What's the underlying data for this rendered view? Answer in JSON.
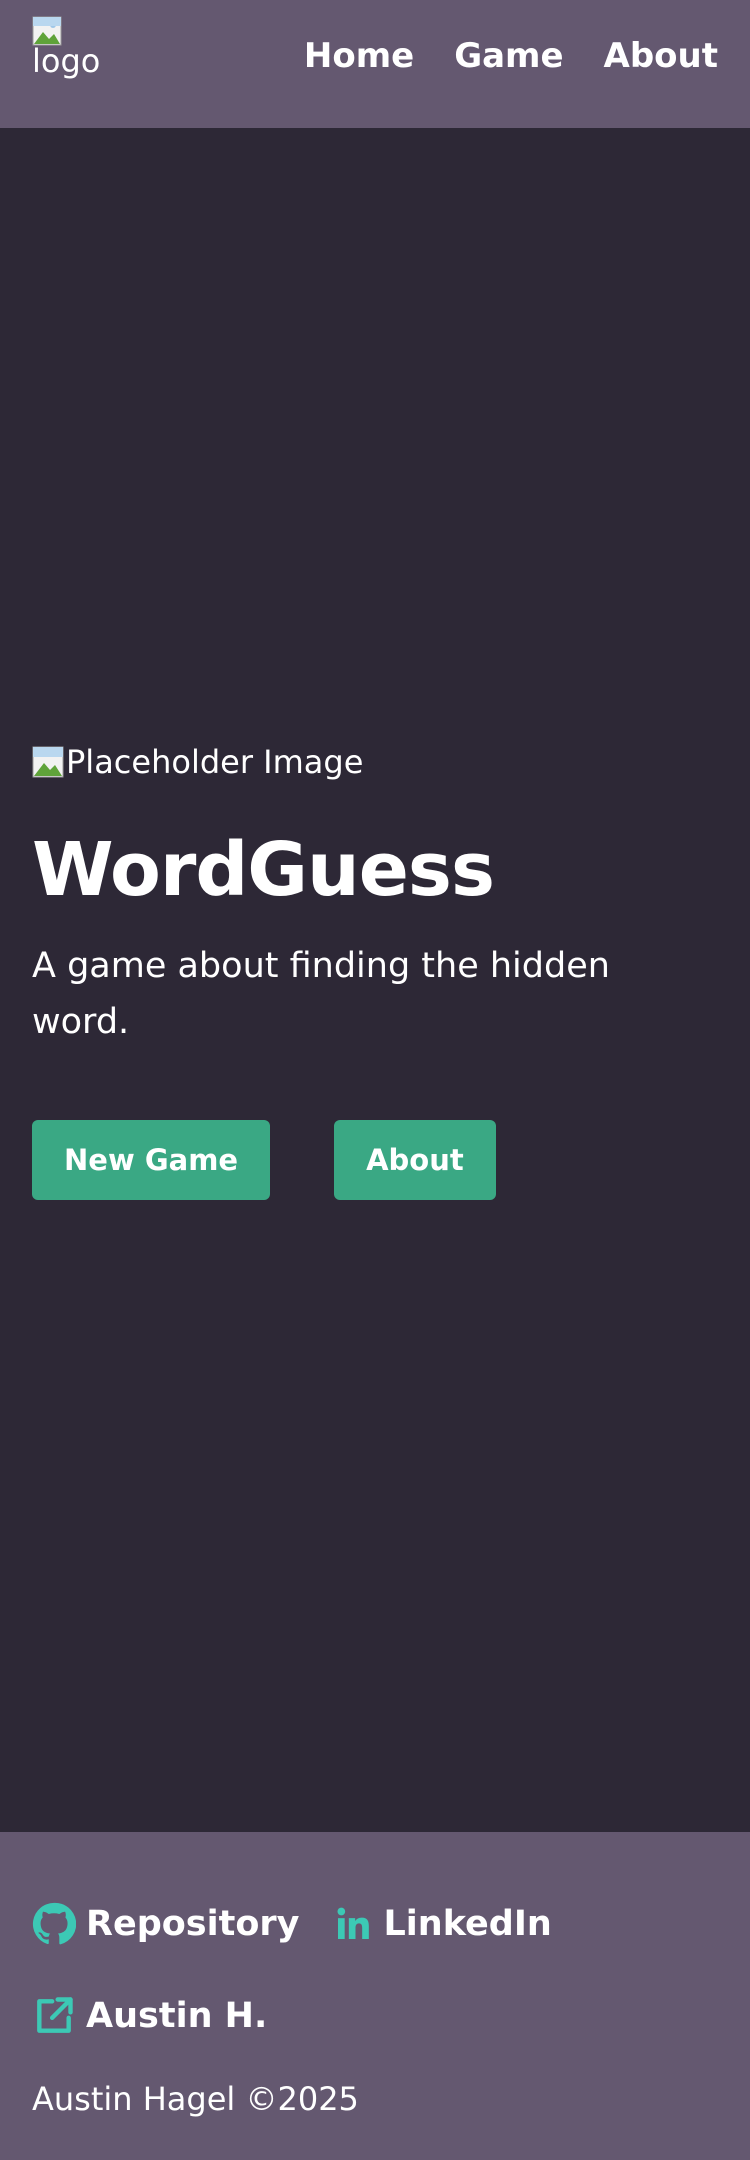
{
  "header": {
    "logo_alt": "logo",
    "nav": [
      {
        "label": "Home"
      },
      {
        "label": "Game"
      },
      {
        "label": "About"
      }
    ]
  },
  "hero": {
    "image_alt": "Placeholder Image",
    "title": "WordGuess",
    "subtitle": "A game about finding the hidden word.",
    "buttons": {
      "new_game": "New Game",
      "about": "About"
    }
  },
  "footer": {
    "links": {
      "repository": "Repository",
      "linkedin": "LinkedIn",
      "author": "Austin H."
    },
    "copyright": "Austin Hagel ©2025",
    "icons": {
      "repository": "github-icon",
      "linkedin": "linkedin-icon",
      "author": "external-link-icon"
    }
  },
  "colors": {
    "background": "#2d2836",
    "header_footer": "#645870",
    "button": "#3aa884",
    "icon_accent": "#3cc9b5",
    "text": "#ffffff"
  }
}
